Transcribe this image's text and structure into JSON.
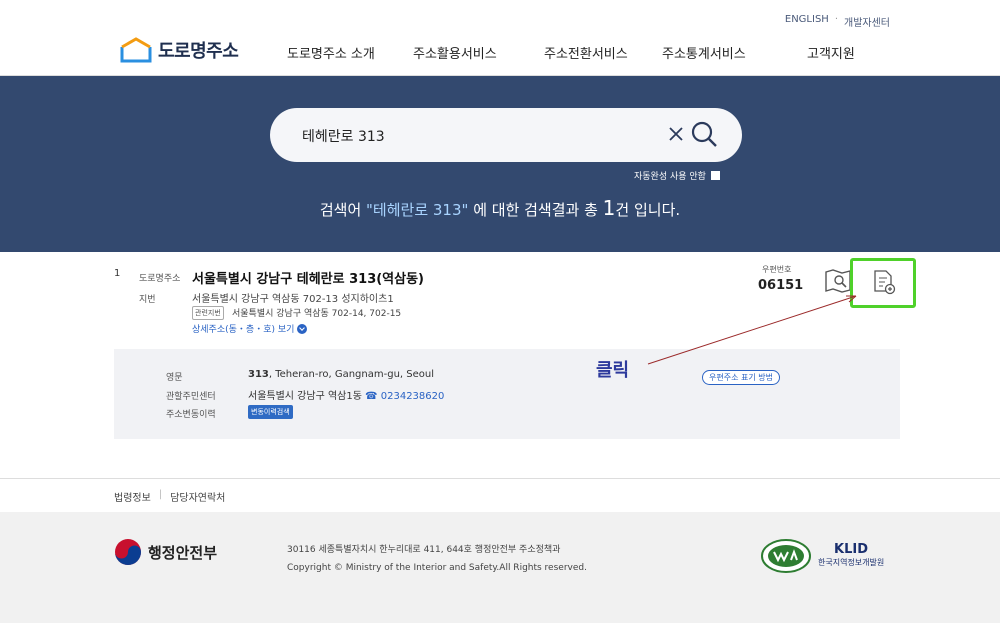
{
  "header": {
    "top_links": [
      "ENGLISH",
      "개발자센터"
    ],
    "logo_text": "도로명주소",
    "menu": [
      "도로명주소 소개",
      "주소활용서비스",
      "주소전환서비스",
      "주소통계서비스",
      "고객지원"
    ]
  },
  "search": {
    "query": "테헤란로 313",
    "autocomplete_label": "자동완성 사용 안함",
    "result_prefix": "검색어 ",
    "result_keyword": "\"테헤란로 313\"",
    "result_middle": " 에 대한 검색결과 총 ",
    "result_count": "1",
    "result_suffix": "건 입니다."
  },
  "result": {
    "number": "1",
    "road_label": "도로명주소",
    "road_address": "서울특별시 강남구 테헤란로 313(역삼동)",
    "jibun_label": "지번",
    "jibun_address": "서울특별시 강남구 역삼동 702-13 성지하이츠1",
    "related_tag": "관련지번",
    "related_address": "서울특별시 강남구 역삼동 702-14, 702-15",
    "detail_link": "상세주소(동・층・호) 보기",
    "zip_label": "우편번호",
    "zip_code": "06151"
  },
  "detail": {
    "english_label": "영문",
    "english_num": "313",
    "english_rest": ", Teheran-ro, Gangnam-gu, Seoul",
    "center_label": "관할주민센터",
    "center_value": "서울특별시 강남구 역삼1동",
    "center_phone": "☎ 0234238620",
    "history_label": "주소변동이력",
    "history_button": "변동이력검색",
    "zip_guide": "우편주소 표기 방법"
  },
  "annotation": {
    "text": "클릭",
    "color": "#2d3a9c"
  },
  "footer": {
    "links": [
      "법령정보",
      "담당자연락처"
    ],
    "ministry": "행정안전부",
    "address": "30116 세종특별자치시 한누리대로 411, 644호 행정안전부 주소정책과",
    "copyright": "Copyright © Ministry of the Interior and Safety.All Rights reserved.",
    "klid_name": "KLID",
    "klid_full": "한국지역정보개발원"
  },
  "colors": {
    "banner": "#33496f",
    "highlight": "#4fd12a",
    "link": "#2a63c4"
  }
}
